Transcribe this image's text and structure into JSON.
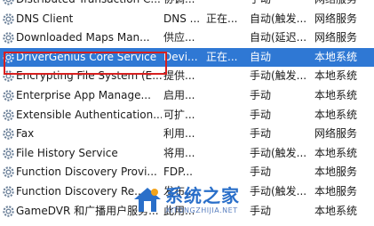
{
  "services": [
    {
      "name": "Distributed Transaction C...",
      "desc": "协调...",
      "status": "",
      "startup": "手动",
      "logon": "网络服务"
    },
    {
      "name": "DNS Client",
      "desc": "DNS ...",
      "status": "正在...",
      "startup": "自动(触发...",
      "logon": "网络服务"
    },
    {
      "name": "Downloaded Maps Man...",
      "desc": "供应...",
      "status": "",
      "startup": "自动(延迟...",
      "logon": "网络服务"
    },
    {
      "name": "DriverGenius Core Service",
      "desc": "Devi...",
      "status": "正在...",
      "startup": "自动",
      "logon": "本地系统",
      "selected": true
    },
    {
      "name": "Encrypting File System (E...",
      "desc": "提供...",
      "status": "",
      "startup": "手动(触发...",
      "logon": "本地系统"
    },
    {
      "name": "Enterprise App Manage...",
      "desc": "启用...",
      "status": "",
      "startup": "手动",
      "logon": "本地系统"
    },
    {
      "name": "Extensible Authentication...",
      "desc": "可扩...",
      "status": "",
      "startup": "手动",
      "logon": "本地系统"
    },
    {
      "name": "Fax",
      "desc": "利用...",
      "status": "",
      "startup": "手动",
      "logon": "网络服务"
    },
    {
      "name": "File History Service",
      "desc": "将用...",
      "status": "",
      "startup": "手动(触发...",
      "logon": "本地系统"
    },
    {
      "name": "Function Discovery Provi...",
      "desc": "FDP...",
      "status": "",
      "startup": "手动",
      "logon": "本地服务"
    },
    {
      "name": "Function Discovery Re...",
      "desc": "发布...",
      "status": "",
      "startup": "手动(触发...",
      "logon": "本地服务"
    },
    {
      "name": "GameDVR 和广播用户服务...",
      "desc": "此用...",
      "status": "",
      "startup": "手动",
      "logon": "本地系统"
    }
  ],
  "watermark": {
    "title": "系统之家",
    "url": "XITONGZHIJIA.NET"
  },
  "colors": {
    "selection": "#2f78d4",
    "highlight_border": "#d72020",
    "watermark": "#2a6fc9"
  }
}
